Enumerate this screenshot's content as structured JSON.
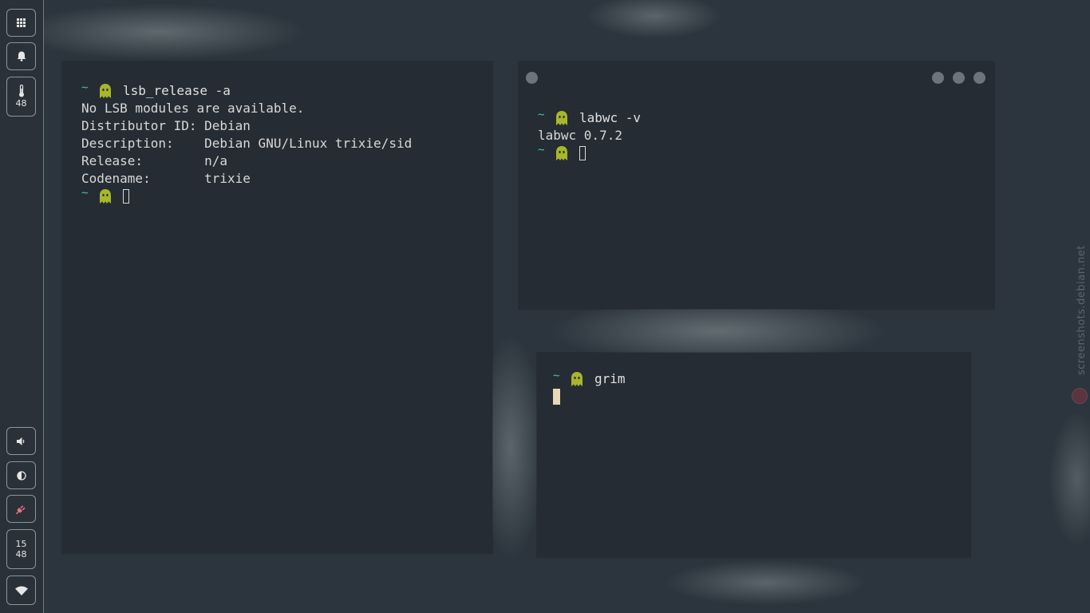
{
  "panel": {
    "temperature": "48",
    "clock_hour": "15",
    "clock_minute": "48"
  },
  "terminal1": {
    "prompt_symbol": "~",
    "command": "lsb_release -a",
    "output": [
      "No LSB modules are available.",
      "Distributor ID: Debian",
      "Description:    Debian GNU/Linux trixie/sid",
      "Release:        n/a",
      "Codename:       trixie"
    ]
  },
  "terminal2": {
    "prompt_symbol": "~",
    "command": "labwc -v",
    "output": [
      "labwc 0.7.2"
    ]
  },
  "terminal3": {
    "prompt_symbol": "~",
    "command": "grim"
  },
  "watermark": "screenshots.debian.net",
  "colors": {
    "prompt_tilde": "#4fc1a6",
    "ghost": "#a8b62a",
    "terminal_bg": "#252c33",
    "panel_bg": "#2a3138",
    "power_icon": "#e8737f"
  },
  "icons": {
    "apps": "grid-icon",
    "notifications": "bell-icon",
    "temperature": "thermometer-icon",
    "volume": "speaker-icon",
    "brightness": "half-circle-icon",
    "power": "plug-icon",
    "network": "wifi-icon",
    "prompt": "ghost-icon"
  }
}
